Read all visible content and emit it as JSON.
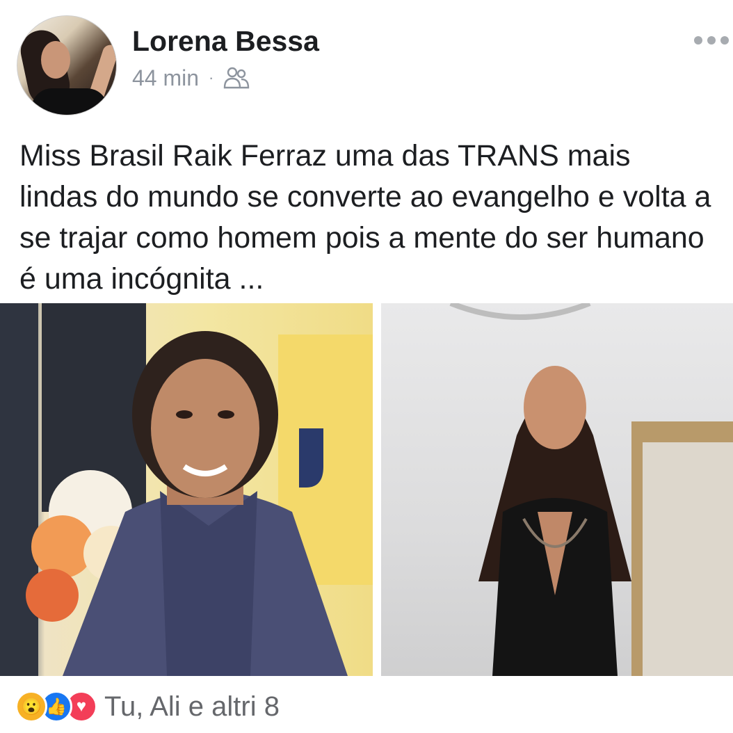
{
  "post": {
    "author": "Lorena Bessa",
    "time": "44 min",
    "separator": "·",
    "audience_icon": "friends-icon",
    "text": "Miss Brasil Raik Ferraz uma das TRANS mais lindas do mundo se converte ao evangelho e volta a se trajar como homem pois a mente do ser humano é uma incógnita ..."
  },
  "reactions": {
    "icons": [
      "wow-icon",
      "like-icon",
      "love-icon"
    ],
    "summary": "Tu, Ali e altri 8"
  },
  "colors": {
    "author": "#1c1e21",
    "meta": "#8d949e",
    "like": "#1877f2",
    "love": "#f33e58",
    "wow": "#f7b125"
  }
}
